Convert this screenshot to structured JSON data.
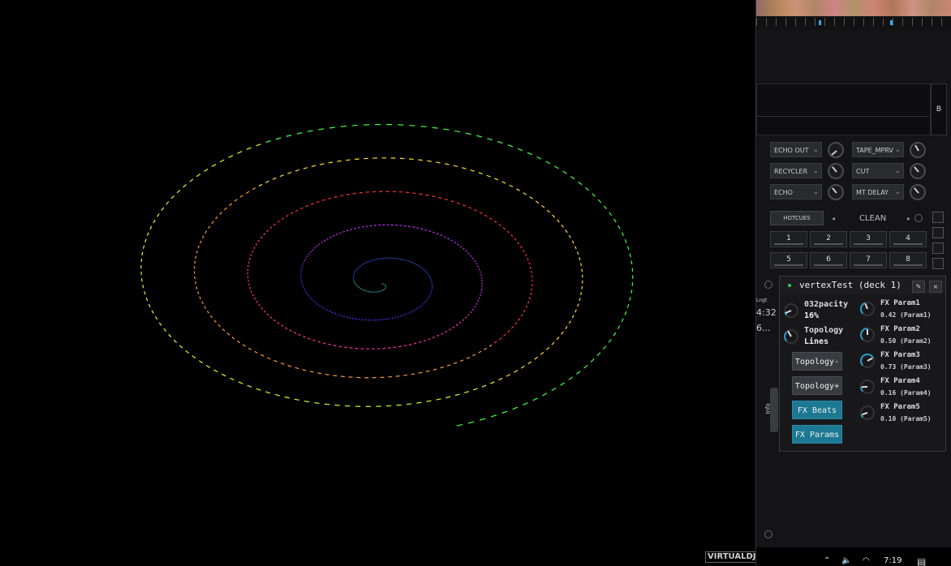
{
  "visualizer": {
    "logo_text": "VIRTUALDJ",
    "colors": [
      "#44ff44",
      "#ccff33",
      "#ffdd33",
      "#ff9933",
      "#ff3333",
      "#ff33aa",
      "#cc33ff",
      "#5533ff",
      "#3366ff",
      "#33ddcc"
    ]
  },
  "waveform": {
    "cue_color": "#33aaff"
  },
  "deck": {
    "side_label": "B"
  },
  "fx_slots": {
    "left": [
      "ECHO OUT",
      "RECYCLER",
      "ECHO"
    ],
    "right": [
      "TAPE_MPRV",
      "CUT",
      "MT DELAY"
    ]
  },
  "hotcues": {
    "label": "HOTCUES",
    "mode": "CLEAN",
    "buttons": [
      "1",
      "2",
      "3",
      "4",
      "5",
      "6",
      "7",
      "8"
    ]
  },
  "side_info": {
    "time": "4:32",
    "small": "Lngt",
    "ellipsis": "6..."
  },
  "fx_window": {
    "title": "vertexTest (deck 1)",
    "pin_icon": "pin-icon",
    "close_icon": "close-icon",
    "params_left": [
      {
        "name": "032pacity",
        "value": "16%"
      },
      {
        "name": "Topology",
        "value": "Lines"
      }
    ],
    "buttons": [
      {
        "label": "Topology-",
        "active": false
      },
      {
        "label": "Topology+",
        "active": false
      },
      {
        "label": "FX Beats",
        "active": true
      },
      {
        "label": "FX Params",
        "active": true
      }
    ],
    "params_right": [
      {
        "name": "FX Param1",
        "value": "0.42 (Param1)",
        "level": 0.42
      },
      {
        "name": "FX Param2",
        "value": "0.50 (Param2)",
        "level": 0.5
      },
      {
        "name": "FX Param3",
        "value": "0.73 (Param3)",
        "level": 0.73
      },
      {
        "name": "FX Param4",
        "value": "0.16 (Param4)",
        "level": 0.16
      },
      {
        "name": "FX Param5",
        "value": "0.10 (Param5)",
        "level": 0.1
      }
    ],
    "info_tab": "Info",
    "accent": "#1c7893"
  },
  "taskbar": {
    "clock": "7:19"
  }
}
